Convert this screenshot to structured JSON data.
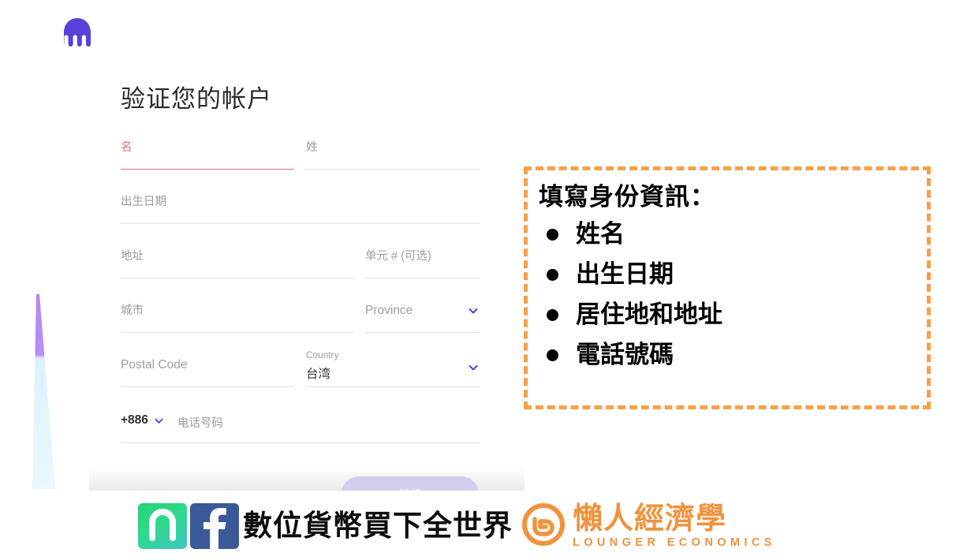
{
  "brand": {
    "logo_icon": "kraken-logo-icon"
  },
  "page": {
    "title": "验证您的帐户"
  },
  "form": {
    "first_name": {
      "label": "名",
      "value": "",
      "required": true
    },
    "last_name": {
      "label": "姓",
      "value": ""
    },
    "date_of_birth": {
      "label": "出生日期",
      "value": ""
    },
    "address": {
      "label": "地址",
      "value": ""
    },
    "unit": {
      "label": "单元 # (可选)",
      "value": ""
    },
    "city": {
      "label": "城市",
      "value": ""
    },
    "province": {
      "label": "Province",
      "value": "",
      "icon": "chevron-down-icon"
    },
    "postal_code": {
      "label": "Postal Code",
      "value": ""
    },
    "country": {
      "label": "Country",
      "value": "台湾",
      "icon": "chevron-down-icon"
    },
    "phone": {
      "dial_code": "+886",
      "dial_icon": "chevron-down-icon",
      "placeholder": "电话号码",
      "value": ""
    },
    "submit": {
      "label": "继续",
      "disabled": true
    }
  },
  "annotation": {
    "title": "填寫身份資訊：",
    "items": [
      {
        "text": "姓名"
      },
      {
        "text": "出生日期"
      },
      {
        "text": "居住地和地址"
      },
      {
        "text": "電話號碼"
      }
    ],
    "border_color": "#f6a04a"
  },
  "footer": {
    "icons": [
      {
        "name": "line-app-icon",
        "color": "#2ed98a"
      },
      {
        "name": "facebook-icon",
        "color": "#3b5998"
      }
    ],
    "tagline": "數位貨幣買下全世界",
    "brand_cn": "懶人經濟學",
    "brand_en": "LOUNGER ECONOMICS",
    "brand_color": "#f1933c"
  },
  "colors": {
    "accent_purple": "#5741d9",
    "error_red": "#e2707c",
    "wedge_purple": "#b388f5",
    "wedge_blue": "#e9f6fd"
  }
}
